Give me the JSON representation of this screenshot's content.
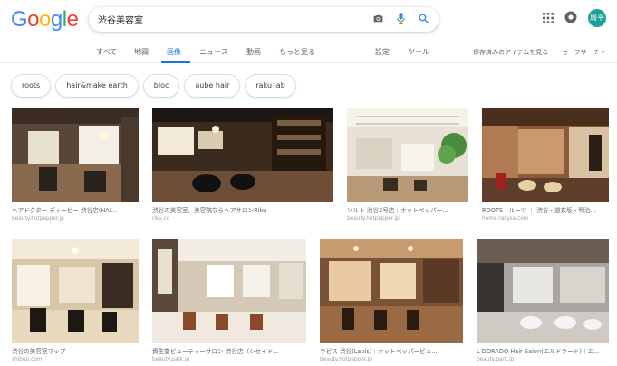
{
  "search": {
    "query": "渋谷美容室"
  },
  "logo": {
    "letters": [
      "G",
      "o",
      "o",
      "g",
      "l",
      "e"
    ],
    "colors": [
      "#4285f4",
      "#ea4335",
      "#fbbc05",
      "#4285f4",
      "#34a853",
      "#ea4335"
    ]
  },
  "account": {
    "avatar_text": "周平"
  },
  "tabs": [
    {
      "label": "すべて"
    },
    {
      "label": "地図"
    },
    {
      "label": "画像"
    },
    {
      "label": "ニュース"
    },
    {
      "label": "動画"
    },
    {
      "label": "もっと見る"
    },
    {
      "label": "設定"
    },
    {
      "label": "ツール"
    },
    {
      "label": "保存済みのアイテムを見る"
    },
    {
      "label": "セーフサーチ ▾"
    }
  ],
  "chips": [
    {
      "label": "roots"
    },
    {
      "label": "hair&make earth"
    },
    {
      "label": "bloc"
    },
    {
      "label": "aube hair"
    },
    {
      "label": "raku lab"
    }
  ],
  "results": [
    {
      "title": "ヘアドクター ディーピー 渋谷店(HAI...",
      "site": "beauty.hotpepper.jp"
    },
    {
      "title": "渋谷の美容室、美容院ならヘアサロンRiku",
      "site": "riku.cc"
    },
    {
      "title": "ソルト 渋谷2号店｜ホットペッパー...",
      "site": "beauty.hotpepper.jp"
    },
    {
      "title": "ROOTS - ルーツ ｜ 渋谷・道玄坂・明治...",
      "site": "home.rasysa.com"
    },
    {
      "title": "渋谷の美容室マップ",
      "site": "shibuu.com"
    },
    {
      "title": "資生堂ビューティーサロン 渋谷店（シセイド...",
      "site": "beauty.park.jp"
    },
    {
      "title": "ラピス 渋谷(Lapis)｜ホットペッパービュ...",
      "site": "beauty.hotpepper.jp"
    },
    {
      "title": "L DORADO Hair Salon(エルドラード)｜エ...",
      "site": "beauty.park.jp"
    }
  ],
  "colors": {
    "accent": "#1a73e8",
    "avatar_bg": "#1aa39a"
  },
  "icons": [
    "camera-icon",
    "microphone-icon",
    "search-icon",
    "apps-grid-icon",
    "notifications-icon"
  ]
}
